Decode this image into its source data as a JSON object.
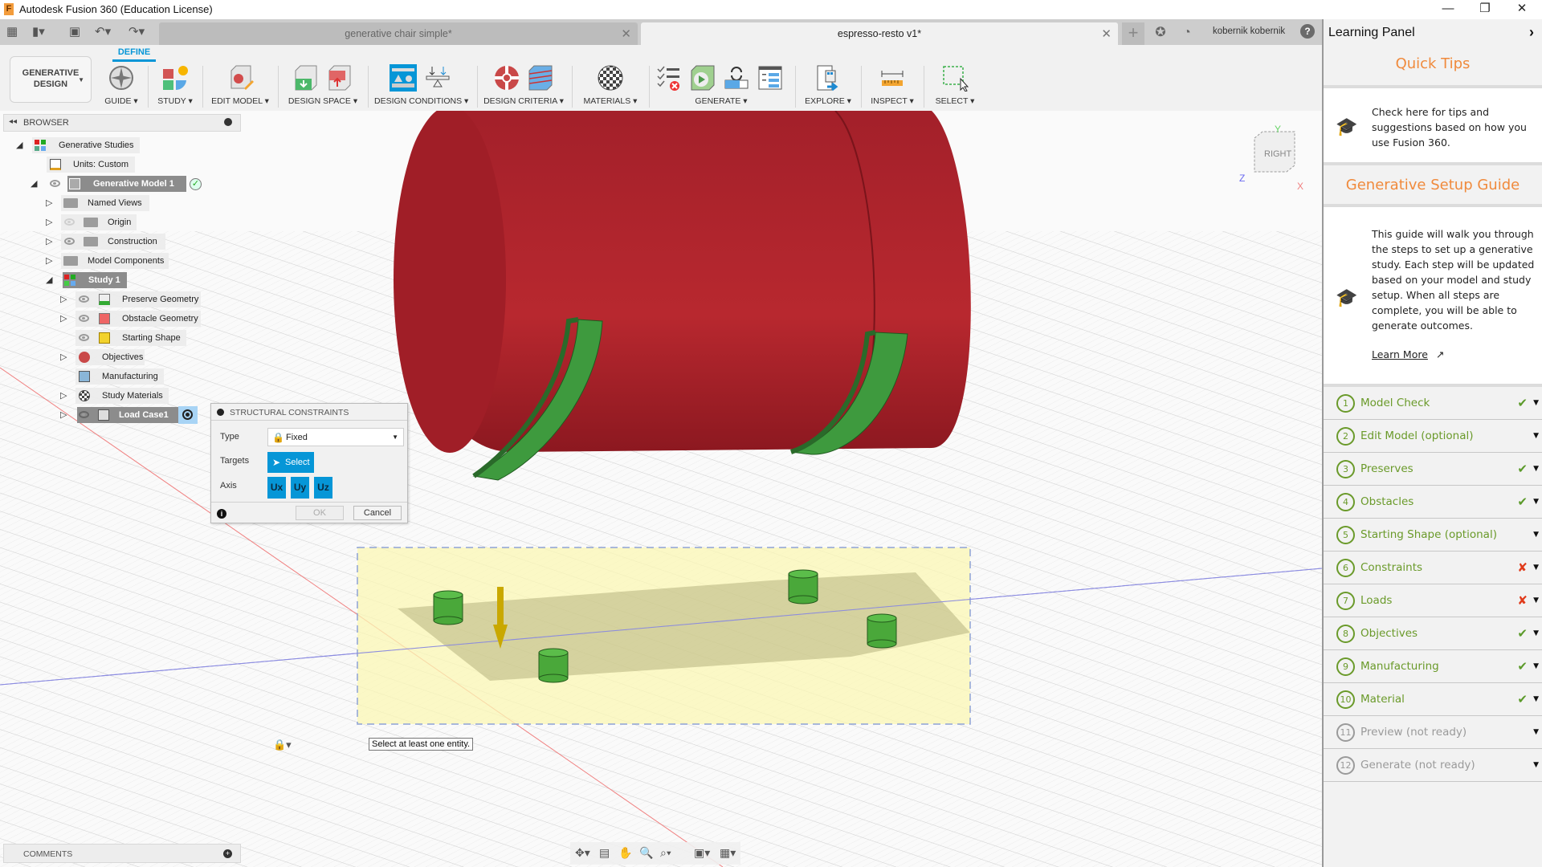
{
  "window": {
    "title": "Autodesk Fusion 360 (Education License)",
    "logo": "F",
    "minimize_icon": "—",
    "restore_icon": "❐",
    "close_icon": "✕"
  },
  "tabs": [
    {
      "label": "generative chair simple*",
      "active": false
    },
    {
      "label": "espresso-resto v1*",
      "active": true
    }
  ],
  "user": {
    "name": "kobernik kobernik",
    "help_icon": "?"
  },
  "ribbon": {
    "workspace": {
      "line1": "GENERATIVE",
      "line2": "DESIGN"
    },
    "active_tab": "DEFINE",
    "groups": [
      {
        "label": "GUIDE ▾"
      },
      {
        "label": "STUDY ▾"
      },
      {
        "label": "EDIT MODEL ▾"
      },
      {
        "label": "DESIGN SPACE ▾"
      },
      {
        "label": "DESIGN CONDITIONS ▾"
      },
      {
        "label": "DESIGN CRITERIA ▾"
      },
      {
        "label": "MATERIALS ▾"
      },
      {
        "label": "GENERATE ▾"
      },
      {
        "label": "EXPLORE ▾"
      },
      {
        "label": "INSPECT ▾"
      },
      {
        "label": "SELECT ▾"
      }
    ]
  },
  "browser": {
    "title": "BROWSER",
    "nodes": [
      {
        "label": "Generative Studies"
      },
      {
        "label": "Units: Custom"
      },
      {
        "label": "Generative Model 1"
      },
      {
        "label": "Named Views"
      },
      {
        "label": "Origin"
      },
      {
        "label": "Construction"
      },
      {
        "label": "Model Components"
      },
      {
        "label": "Study 1"
      },
      {
        "label": "Preserve Geometry"
      },
      {
        "label": "Obstacle Geometry"
      },
      {
        "label": "Starting Shape"
      },
      {
        "label": "Objectives"
      },
      {
        "label": "Manufacturing"
      },
      {
        "label": "Study Materials"
      },
      {
        "label": "Load Case1"
      }
    ]
  },
  "dialog": {
    "title": "STRUCTURAL CONSTRAINTS",
    "type_label": "Type",
    "type_value": "Fixed",
    "targets_label": "Targets",
    "select_label": "Select",
    "axis_label": "Axis",
    "axes": [
      "Ux",
      "Uy",
      "Uz"
    ],
    "ok_label": "OK",
    "cancel_label": "Cancel"
  },
  "tooltip": "Select at least one entity.",
  "comments": {
    "title": "COMMENTS"
  },
  "viewcube": {
    "face": "RIGHT",
    "x": "X",
    "y": "Y",
    "z": "Z"
  },
  "learning_panel": {
    "title": "Learning Panel",
    "quick_tips": {
      "heading": "Quick Tips",
      "text": "Check here for tips and suggestions based on how you use Fusion 360."
    },
    "setup_guide": {
      "heading": "Generative Setup Guide",
      "text": "This guide will walk you through the steps to set up a generative study. Each step will be updated based on your model and study setup. When all steps are complete, you will be able to generate outcomes.",
      "learn_more": "Learn More"
    },
    "steps": [
      {
        "num": "1",
        "label": "Model Check",
        "status": "✔",
        "state": "ok"
      },
      {
        "num": "2",
        "label": "Edit Model (optional)",
        "status": "",
        "state": "none"
      },
      {
        "num": "3",
        "label": "Preserves",
        "status": "✔",
        "state": "ok"
      },
      {
        "num": "4",
        "label": "Obstacles",
        "status": "✔",
        "state": "ok"
      },
      {
        "num": "5",
        "label": "Starting Shape (optional)",
        "status": "",
        "state": "none"
      },
      {
        "num": "6",
        "label": "Constraints",
        "status": "✘",
        "state": "bad"
      },
      {
        "num": "7",
        "label": "Loads",
        "status": "✘",
        "state": "bad"
      },
      {
        "num": "8",
        "label": "Objectives",
        "status": "✔",
        "state": "ok"
      },
      {
        "num": "9",
        "label": "Manufacturing",
        "status": "✔",
        "state": "ok"
      },
      {
        "num": "10",
        "label": "Material",
        "status": "✔",
        "state": "ok"
      },
      {
        "num": "11",
        "label": "Preview (not ready)",
        "status": "",
        "state": "disabled"
      },
      {
        "num": "12",
        "label": "Generate (not ready)",
        "status": "",
        "state": "disabled"
      }
    ]
  }
}
